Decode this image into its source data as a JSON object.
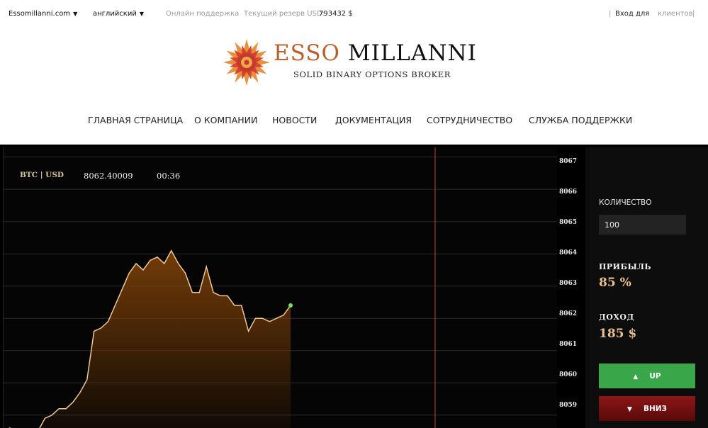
{
  "topbar": {
    "site_selector": "Essomillanni.com",
    "language_selector": "английский",
    "dropdown_arrow": "▼",
    "support_link": "Онлайн поддержка",
    "reserve_label": "Текущий резерв USD:",
    "reserve_value": "793432 $",
    "login_link": "Вход для",
    "clients_link": "клиентов"
  },
  "logo": {
    "brand_prefix": "ESSO",
    "brand_suffix": " MILLANNI",
    "tagline": "SOLID BINARY OPTIONS BROKER"
  },
  "nav": {
    "items": [
      "ГЛАВНАЯ СТРАНИЦА",
      "О КОМПАНИИ",
      "НОВОСТИ",
      "ДОКУМЕНТАЦИЯ",
      "СОТРУДНИЧЕСТВО",
      "СЛУЖБА ПОДДЕРЖКИ"
    ]
  },
  "chart": {
    "pair": "BTC | USD",
    "price": "8062.40009",
    "timer": "00:36",
    "y_labels": [
      "8067",
      "8066",
      "8065",
      "8064",
      "8063",
      "8062",
      "8061",
      "8060",
      "8059"
    ]
  },
  "panel": {
    "quantity_label": "КОЛИЧЕСТВО",
    "quantity_value": "100",
    "profit_label": "ПРИБЫЛЬ",
    "profit_value": "85 %",
    "income_label": "ДОХОД",
    "income_value": "185 $",
    "up_label": "UP",
    "down_label": "ВНИЗ",
    "up_icon": "▲",
    "down_icon": "▼"
  },
  "chart_data": {
    "type": "area",
    "ylim": [
      8058.6,
      8067.3
    ],
    "series": [
      {
        "values": [
          8058.5,
          8058.6,
          8058.5,
          8058.5,
          8058.3,
          8058.5,
          8058.9,
          8059.0,
          8059.2,
          8059.2,
          8059.4,
          8059.7,
          8060.1,
          8061.6,
          8061.7,
          8061.9,
          8062.4,
          8062.9,
          8063.4,
          8063.7,
          8063.5,
          8063.8,
          8063.9,
          8063.7,
          8064.1,
          8063.7,
          8063.4,
          8062.8,
          8062.8,
          8063.6,
          8062.8,
          8062.7,
          8062.7,
          8062.4,
          8062.4,
          8061.6,
          8062.0,
          8062.0,
          8061.9,
          8062.0,
          8062.1,
          8062.4
        ]
      }
    ]
  },
  "colors": {
    "line": "#f0c796",
    "area": "#7a3f08",
    "marker": "#7ddc6a",
    "vertical_marker": "#c5452a",
    "up_button": "#3aa64a",
    "down_button": "#8c1717"
  }
}
